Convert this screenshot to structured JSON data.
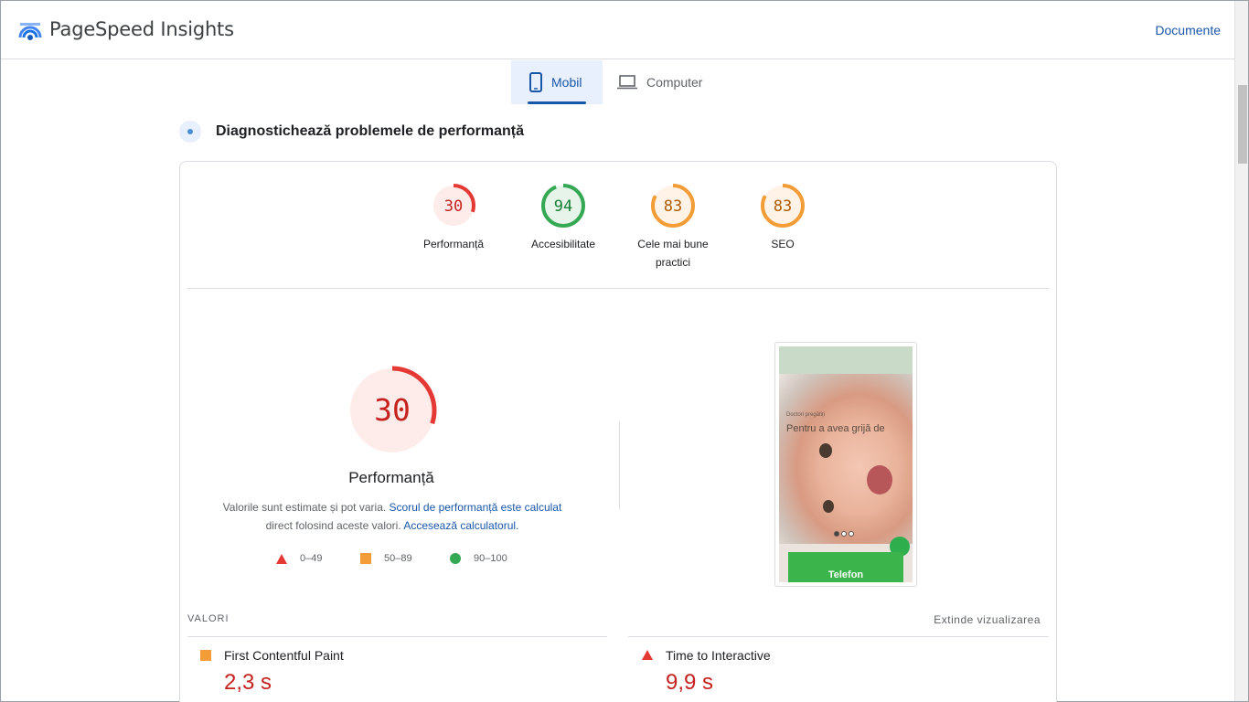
{
  "header": {
    "title": "PageSpeed Insights",
    "docs_link": "Documente"
  },
  "tabs": [
    {
      "label": "Mobil",
      "icon": "phone-icon",
      "active": true
    },
    {
      "label": "Computer",
      "icon": "laptop-icon",
      "active": false
    }
  ],
  "diagnose_title": "Diagnostichează problemele de performanță",
  "scores": [
    {
      "value": "30",
      "label": "Performanță",
      "score": 30,
      "color": "#e53935",
      "bg": "#fdece9",
      "text": "#c5221f"
    },
    {
      "value": "94",
      "label": "Accesibilitate",
      "score": 94,
      "color": "#34a853",
      "bg": "#e6f4ea",
      "text": "#188038"
    },
    {
      "value": "83",
      "label": "Cele mai bune practici",
      "score": 83,
      "color": "#f29d38",
      "bg": "#fef3e6",
      "text": "#b05a00"
    },
    {
      "value": "83",
      "label": "SEO",
      "score": 83,
      "color": "#f29d38",
      "bg": "#fef3e6",
      "text": "#b05a00"
    }
  ],
  "performance": {
    "value": "30",
    "score": 30,
    "title": "Performanță",
    "desc_prefix": "Valorile sunt estimate și pot varia.",
    "desc_link1": "Scorul de performanță este calculat",
    "desc_mid": "direct folosind aceste valori.",
    "desc_link2": "Accesează calculatorul."
  },
  "legend": [
    {
      "shape": "triangle",
      "label": "0–49",
      "color": "#e53935"
    },
    {
      "shape": "square",
      "label": "50–89",
      "color": "#f29d38"
    },
    {
      "shape": "circle",
      "label": "90–100",
      "color": "#34a853"
    }
  ],
  "screenshot": {
    "small_text": "Doctori pregătiți",
    "headline": "Pentru a avea grijă de",
    "button": "Telefon"
  },
  "values_label": "VALORI",
  "expand_label": "Extinde vizualizarea",
  "metrics": [
    {
      "name": "First Contentful Paint",
      "value": "2,3 s",
      "shape": "square",
      "color": "#f29d38"
    },
    {
      "name": "Time to Interactive",
      "value": "9,9 s",
      "shape": "triangle",
      "color": "#e53935"
    }
  ]
}
